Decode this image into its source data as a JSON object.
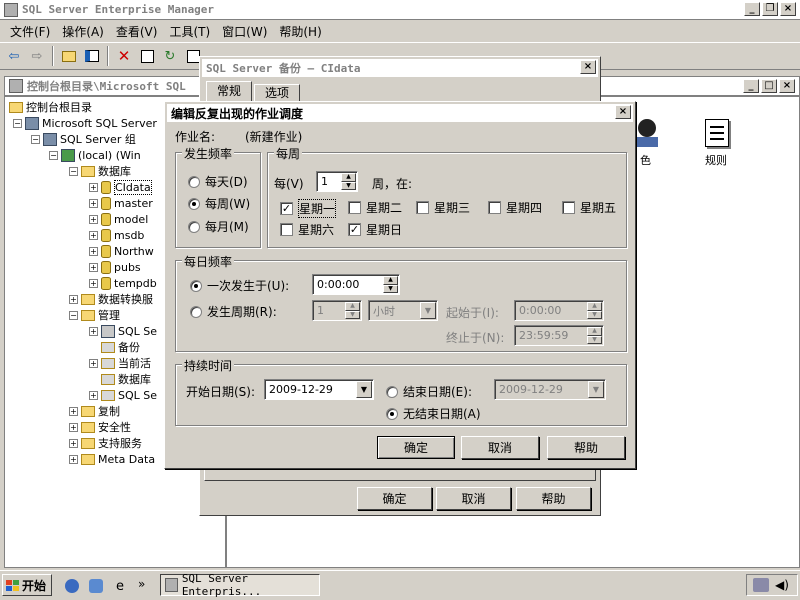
{
  "main_window": {
    "title": "SQL Server Enterprise Manager",
    "buttons": [
      "_",
      "❐",
      "×"
    ]
  },
  "menu": [
    "文件(F)",
    "操作(A)",
    "查看(V)",
    "工具(T)",
    "窗口(W)",
    "帮助(H)"
  ],
  "console": {
    "title": "控制台根目录\\Microsoft SQL",
    "buttons": [
      "_",
      "□",
      "×"
    ],
    "tree": [
      {
        "label": "控制台根目录",
        "icon": "folder"
      },
      {
        "label": "Microsoft SQL Server",
        "icon": "server"
      },
      {
        "label": "SQL Server 组",
        "icon": "server"
      },
      {
        "label": "(local) (Win",
        "icon": "server"
      },
      {
        "label": "数据库",
        "icon": "folder"
      },
      {
        "label": "CIdata",
        "icon": "database"
      },
      {
        "label": "master",
        "icon": "database"
      },
      {
        "label": "model",
        "icon": "database"
      },
      {
        "label": "msdb",
        "icon": "database"
      },
      {
        "label": "Northw",
        "icon": "database"
      },
      {
        "label": "pubs",
        "icon": "database"
      },
      {
        "label": "tempdb",
        "icon": "database"
      },
      {
        "label": "数据转换服",
        "icon": "folder"
      },
      {
        "label": "管理",
        "icon": "folder"
      },
      {
        "label": "SQL Se",
        "icon": "server"
      },
      {
        "label": "备份",
        "icon": "folder"
      },
      {
        "label": "当前活",
        "icon": "folder"
      },
      {
        "label": "数据库",
        "icon": "folder"
      },
      {
        "label": "SQL Se",
        "icon": "folder"
      },
      {
        "label": "复制",
        "icon": "folder"
      },
      {
        "label": "安全性",
        "icon": "folder"
      },
      {
        "label": "支持服务",
        "icon": "folder"
      },
      {
        "label": "Meta Data",
        "icon": "folder"
      }
    ],
    "right_items": [
      "色",
      "规则"
    ]
  },
  "backup_dialog": {
    "title": "SQL Server 备份 — CIdata",
    "tabs": [
      "常规",
      "选项"
    ],
    "buttons": {
      "ok": "确定",
      "cancel": "取消",
      "help": "帮助"
    }
  },
  "edit_dialog": {
    "title": "编辑反复出现的作业调度",
    "job_name_label": "作业名:",
    "job_name_value": "(新建作业)",
    "frequency": {
      "label": "发生频率",
      "options": [
        "每天(D)",
        "每周(W)",
        "每月(M)"
      ],
      "selected": "每周(W)"
    },
    "weekly": {
      "label": "每周",
      "every_label": "每(V)",
      "every_value": "1",
      "weeks_on": "周，在:",
      "days": [
        {
          "label": "星期一",
          "checked": true
        },
        {
          "label": "星期二",
          "checked": false
        },
        {
          "label": "星期三",
          "checked": false
        },
        {
          "label": "星期四",
          "checked": false
        },
        {
          "label": "星期五",
          "checked": false
        },
        {
          "label": "星期六",
          "checked": false
        },
        {
          "label": "星期日",
          "checked": true
        }
      ]
    },
    "daily": {
      "label": "每日频率",
      "once_label": "一次发生于(U):",
      "once_value": "0:00:00",
      "every_label": "发生周期(R):",
      "every_value": "1",
      "unit_value": "小时",
      "start_label": "起始于(I):",
      "start_value": "0:00:00",
      "end_label": "终止于(N):",
      "end_value": "23:59:59"
    },
    "duration": {
      "label": "持续时间",
      "start_label": "开始日期(S):",
      "start_value": "2009-12-29",
      "end_label": "结束日期(E):",
      "end_value": "2009-12-29",
      "no_end_label": "无结束日期(A)"
    },
    "buttons": {
      "ok": "确定",
      "cancel": "取消",
      "help": "帮助"
    }
  },
  "taskbar": {
    "start": "开始",
    "task": "SQL Server Enterpris...",
    "chevron": "»"
  }
}
